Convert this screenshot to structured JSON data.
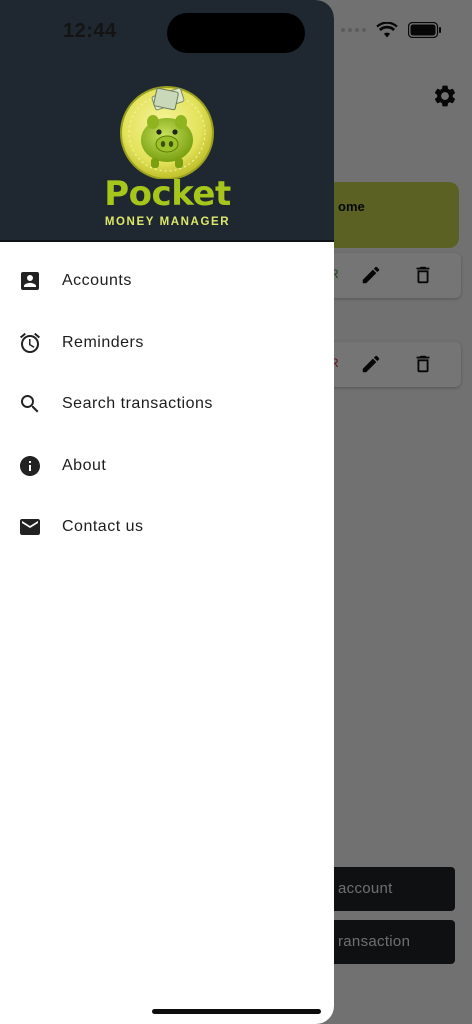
{
  "status_bar": {
    "time": "12:44"
  },
  "drawer": {
    "logo": {
      "title": "Pocket",
      "subtitle": "MONEY MANAGER"
    },
    "items": [
      {
        "label": "Accounts",
        "icon": "account-box-icon"
      },
      {
        "label": "Reminders",
        "icon": "alarm-icon"
      },
      {
        "label": "Search transactions",
        "icon": "search-icon"
      },
      {
        "label": "About",
        "icon": "info-icon"
      },
      {
        "label": "Contact us",
        "icon": "mail-icon"
      }
    ]
  },
  "background": {
    "income_card_label": "ome",
    "accounts": [
      {
        "amount_fragment": "R",
        "color": "#3a9a3a"
      },
      {
        "amount_fragment": "R",
        "color": "#d03030"
      }
    ],
    "bottom_buttons": [
      {
        "label": "account"
      },
      {
        "label": "ransaction"
      }
    ]
  },
  "colors": {
    "header_bg": "#1f2830",
    "logo_green": "#a6c61c",
    "income_card": "#c4d44a"
  }
}
